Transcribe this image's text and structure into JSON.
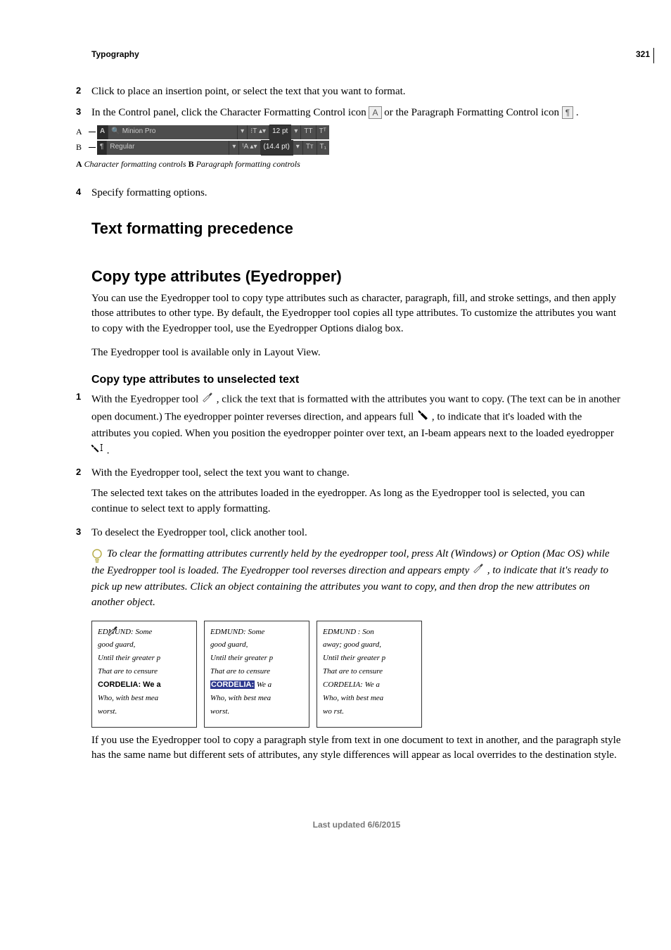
{
  "page_number": "321",
  "chapter": "Typography",
  "steps_top": [
    {
      "num": "2",
      "text": "Click to place an insertion point, or select the text that you want to format."
    },
    {
      "num": "3",
      "text_parts": [
        "In the Control panel, click the Character Formatting Control icon ",
        " or the Paragraph Formatting Control icon ",
        "."
      ]
    }
  ],
  "char_icon": "A",
  "para_icon": "¶",
  "control_panel": {
    "rowA": {
      "label": "A",
      "mode": "A",
      "font": "Minion Pro",
      "size_label": "12 pt",
      "caps1": "TT",
      "caps2": "Tᵀ"
    },
    "rowB": {
      "label": "B",
      "mode": "¶",
      "style": "Regular",
      "leading_label": "(14.4 pt)",
      "sc1": "Tᴛ",
      "sc2": "T₁"
    },
    "caption_prefixA": "A",
    "caption_textA": " Character formatting controls  ",
    "caption_prefixB": "B",
    "caption_textB": " Paragraph formatting controls"
  },
  "step4": {
    "num": "4",
    "text": "Specify formatting options."
  },
  "h2_precedence": "Text formatting precedence",
  "h2_copy": "Copy type attributes (Eyedropper)",
  "copy_intro": "You can use the Eyedropper tool to copy type attributes such as character, paragraph, fill, and stroke settings, and then apply those attributes to other type. By default, the Eyedropper tool copies all type attributes. To customize the attributes you want to copy with the Eyedropper tool, use the Eyedropper Options dialog box.",
  "copy_note": "The Eyedropper tool is available only in Layout View.",
  "h3_unselected": "Copy type attributes to unselected text",
  "unselected_steps": {
    "s1_num": "1",
    "s1_a": "With the Eyedropper tool ",
    "s1_b": " , click the text that is formatted with the attributes you want to copy. (The text can be in another open document.) The eyedropper pointer reverses direction, and appears full ",
    "s1_c": " , to indicate that it's loaded with the attributes you copied. When you position the eyedropper pointer over text, an I-beam appears next to the loaded eyedropper ",
    "s1_d": ".",
    "s2_num": "2",
    "s2": "With the Eyedropper tool, select the text you want to change.",
    "s2_follow": "The selected text takes on the attributes loaded in the eyedropper. As long as the Eyedropper tool is selected, you can continue to select text to apply formatting.",
    "s3_num": "3",
    "s3": "To deselect the Eyedropper tool, click another tool."
  },
  "tip": {
    "a": "To clear the formatting attributes currently held by the eyedropper tool, press Alt (Windows) or Option (Mac OS) while the Eyedropper tool is loaded. The Eyedropper tool reverses direction and appears empty ",
    "b": " , to indicate that it's ready to pick up new attributes. Click an object containing the attributes you want to copy, and then drop the new attributes on another object."
  },
  "examples": [
    {
      "lines": [
        "EDMUND: Some",
        "good guard,",
        "Until their greater p",
        "That are to censure",
        "CORDELIA: We a",
        "Who, with best mea",
        "worst."
      ],
      "styles": [
        "bi",
        "i",
        "i",
        "i",
        "bold",
        "i",
        "i"
      ],
      "eyedropper": true
    },
    {
      "lines": [
        "EDMUND: Some",
        "good guard,",
        "Until their greater p",
        "That are to censure",
        "CORDELIA: We a",
        "Who, with best mea",
        "worst."
      ],
      "styles": [
        "bi",
        "i",
        "i",
        "i",
        "hl",
        "i",
        "i"
      ],
      "eyedropper": false
    },
    {
      "lines": [
        "EDMUND : Son",
        "away; good guard,",
        "Until their greater p",
        "That are to censure",
        "CORDELIA: We a",
        "Who, with best mea",
        "wo rst."
      ],
      "styles": [
        "i",
        "i",
        "i",
        "i",
        "i",
        "i",
        "i"
      ],
      "eyedropper": false
    }
  ],
  "post_example": "If you use the Eyedropper tool to copy a paragraph style from text in one document to text in another, and the paragraph style has the same name but different sets of attributes, any style differences will appear as local overrides to the destination style.",
  "footer": "Last updated 6/6/2015",
  "icons": {
    "eyedropper_empty": "eyedropper-empty-icon",
    "eyedropper_full": "eyedropper-full-icon",
    "eyedropper_ibeam": "eyedropper-ibeam-icon",
    "lightbulb": "tip-lightbulb-icon"
  }
}
